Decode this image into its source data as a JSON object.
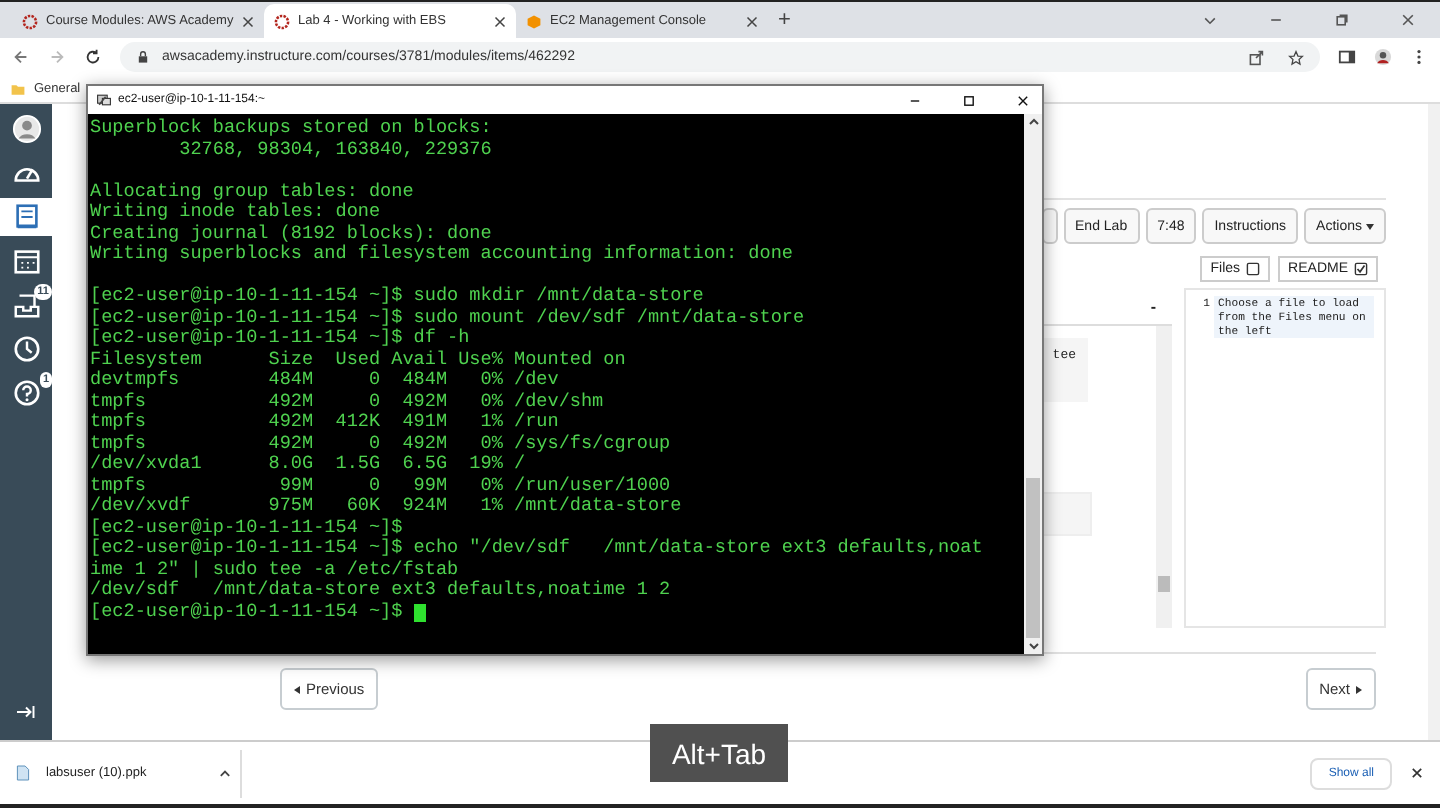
{
  "browser": {
    "tabs": [
      {
        "title": "Course Modules: AWS Academy",
        "selected": false,
        "kind": "canvas"
      },
      {
        "title": "Lab 4 - Working with EBS",
        "selected": true,
        "kind": "canvas"
      },
      {
        "title": "EC2 Management Console",
        "selected": false,
        "kind": "aws"
      }
    ],
    "new_tab": "+",
    "url": "awsacademy.instructure.com/courses/3781/modules/items/462292",
    "bookmarks": [
      "General"
    ]
  },
  "sidebar": {
    "items": [
      {
        "kind": "account",
        "selected": false
      },
      {
        "kind": "dashboard",
        "selected": false
      },
      {
        "kind": "courses",
        "selected": true
      },
      {
        "kind": "calendar",
        "selected": false
      },
      {
        "kind": "inbox",
        "selected": false,
        "badge": "11"
      },
      {
        "kind": "history",
        "selected": false
      },
      {
        "kind": "help",
        "selected": false,
        "badge": "1"
      }
    ]
  },
  "terminal": {
    "title": "ec2-user@ip-10-1-11-154:~",
    "blocks": [
      [
        "Superblock backups stored on blocks:",
        "        32768, 98304, 163840, 229376"
      ],
      [
        "Allocating group tables: done",
        "Writing inode tables: done",
        "Creating journal (8192 blocks): done",
        "Writing superblocks and filesystem accounting information: done"
      ],
      [
        "[ec2-user@ip-10-1-11-154 ~]$ sudo mkdir /mnt/data-store",
        "[ec2-user@ip-10-1-11-154 ~]$ sudo mount /dev/sdf /mnt/data-store",
        "[ec2-user@ip-10-1-11-154 ~]$ df -h",
        "Filesystem      Size  Used Avail Use% Mounted on",
        "devtmpfs        484M     0  484M   0% /dev",
        "tmpfs           492M     0  492M   0% /dev/shm",
        "tmpfs           492M  412K  491M   1% /run",
        "tmpfs           492M     0  492M   0% /sys/fs/cgroup",
        "/dev/xvda1      8.0G  1.5G  6.5G  19% /",
        "tmpfs            99M     0   99M   0% /run/user/1000",
        "/dev/xvdf       975M   60K  924M   1% /mnt/data-store",
        "[ec2-user@ip-10-1-11-154 ~]$",
        "[ec2-user@ip-10-1-11-154 ~]$ echo \"/dev/sdf   /mnt/data-store ext3 defaults,noat",
        "ime 1 2\" | sudo tee -a /etc/fstab",
        "/dev/sdf   /mnt/data-store ext3 defaults,noatime 1 2",
        "[ec2-user@ip-10-1-11-154 ~]$ "
      ]
    ]
  },
  "lab": {
    "toolbar": [
      "End Lab",
      "7:48",
      "Instructions",
      "Actions"
    ],
    "toggles": [
      {
        "label": "Files",
        "checked": false
      },
      {
        "label": "README",
        "checked": true
      }
    ],
    "left_pane": {
      "header": "-",
      "snippet": "tee"
    },
    "editor": {
      "line_number": "1",
      "text": "Choose a file to load from the Files menu on the left"
    }
  },
  "navigation": {
    "previous": "Previous",
    "next": "Next"
  },
  "downloads": {
    "file": "labsuser (10).ppk",
    "show_all": "Show all"
  },
  "overlay": "Alt+Tab"
}
